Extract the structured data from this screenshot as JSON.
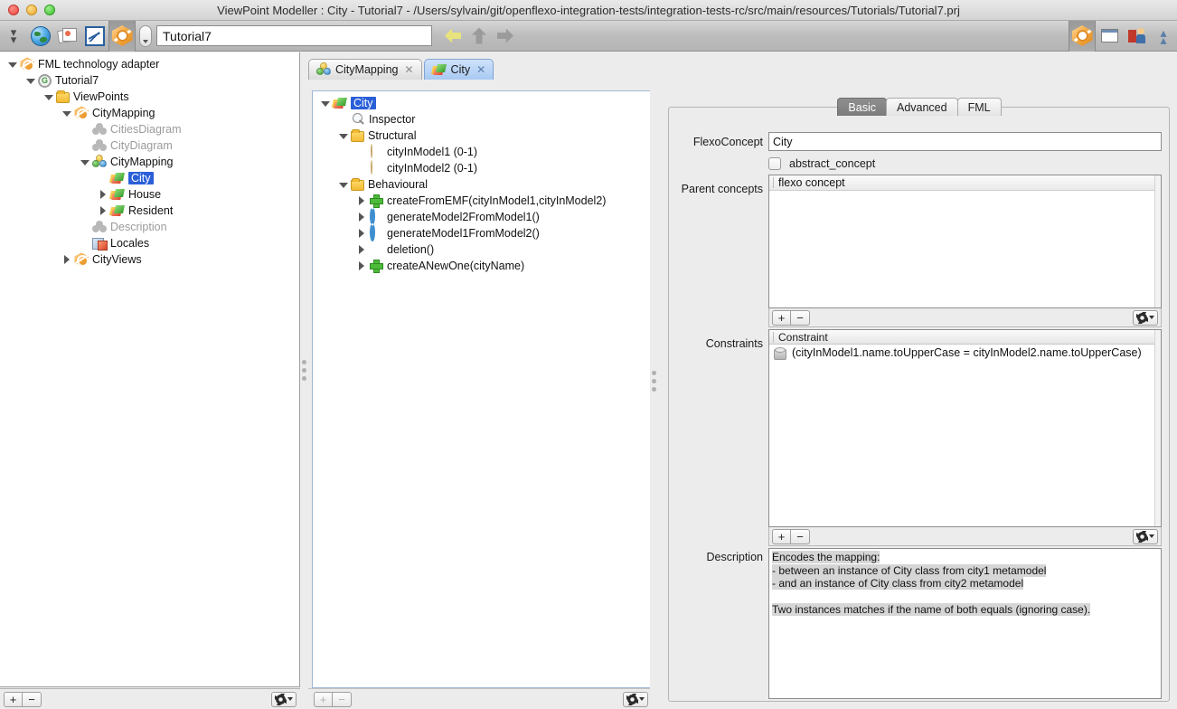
{
  "window": {
    "title": "ViewPoint Modeller : City - Tutorial7 - /Users/sylvain/git/openflexo-integration-tests/integration-tests-rc/src/main/resources/Tutorials/Tutorial7.prj"
  },
  "toolbar": {
    "icons": [
      "chevrons-down-icon",
      "globe-icon",
      "photos-icon",
      "pen-icon",
      "fml-icon"
    ],
    "combo_label": "",
    "url_value": "Tutorial7",
    "nav": [
      "back-arrow-icon",
      "up-arrow-icon",
      "forward-arrow-icon"
    ],
    "right_icons": [
      "fml-icon",
      "window-icon",
      "user-icon",
      "chevrons-up-icon"
    ]
  },
  "sidebar": {
    "items": [
      {
        "label": "FML technology adapter",
        "indent": 0,
        "twist": "down",
        "icon": "fml-icon",
        "dim": false,
        "selected": false
      },
      {
        "label": "Tutorial7",
        "indent": 1,
        "twist": "down",
        "icon": "project-icon",
        "dim": false,
        "selected": false
      },
      {
        "label": "ViewPoints",
        "indent": 2,
        "twist": "down",
        "icon": "folder-icon",
        "dim": false,
        "selected": false
      },
      {
        "label": "CityMapping",
        "indent": 3,
        "twist": "down",
        "icon": "fml-icon",
        "dim": false,
        "selected": false
      },
      {
        "label": "CitiesDiagram",
        "indent": 4,
        "twist": "none",
        "icon": "gray-cluster-icon",
        "dim": true,
        "selected": false
      },
      {
        "label": "CityDiagram",
        "indent": 4,
        "twist": "none",
        "icon": "gray-cluster-icon",
        "dim": true,
        "selected": false
      },
      {
        "label": "CityMapping",
        "indent": 4,
        "twist": "down",
        "icon": "virtual-model-icon",
        "dim": false,
        "selected": false
      },
      {
        "label": "City",
        "indent": 5,
        "twist": "none",
        "icon": "concept-icon",
        "dim": false,
        "selected": true
      },
      {
        "label": "House",
        "indent": 5,
        "twist": "right",
        "icon": "concept-icon",
        "dim": false,
        "selected": false
      },
      {
        "label": "Resident",
        "indent": 5,
        "twist": "right",
        "icon": "concept-icon",
        "dim": false,
        "selected": false
      },
      {
        "label": "Description",
        "indent": 4,
        "twist": "none",
        "icon": "gray-cluster-icon",
        "dim": true,
        "selected": false
      },
      {
        "label": "Locales",
        "indent": 4,
        "twist": "none",
        "icon": "locales-icon",
        "dim": false,
        "selected": false
      },
      {
        "label": "CityViews",
        "indent": 3,
        "twist": "right",
        "icon": "fml-icon",
        "dim": false,
        "selected": false
      }
    ],
    "footer": {
      "add_label": "+",
      "remove_label": "−",
      "gear": "gear-icon"
    }
  },
  "editor": {
    "tabs": [
      {
        "label": "CityMapping",
        "icon": "virtual-model-icon",
        "close": "✕",
        "active": false
      },
      {
        "label": "City",
        "icon": "concept-icon",
        "close": "✕",
        "active": true
      }
    ],
    "tree": [
      {
        "label": "City",
        "indent": 0,
        "twist": "down",
        "icon": "concept-icon",
        "selected": true
      },
      {
        "label": "Inspector",
        "indent": 1,
        "twist": "none",
        "icon": "magnifier-icon",
        "selected": false
      },
      {
        "label": "Structural",
        "indent": 1,
        "twist": "down",
        "icon": "folder-icon",
        "selected": false
      },
      {
        "label": "cityInModel1 (0-1)",
        "indent": 2,
        "twist": "none",
        "icon": "role-icon",
        "selected": false
      },
      {
        "label": "cityInModel2 (0-1)",
        "indent": 2,
        "twist": "none",
        "icon": "role-icon",
        "selected": false
      },
      {
        "label": "Behavioural",
        "indent": 1,
        "twist": "down",
        "icon": "folder-icon",
        "selected": false
      },
      {
        "label": "createFromEMF(cityInModel1,cityInModel2)",
        "indent": 2,
        "twist": "right",
        "icon": "green-plus-icon",
        "selected": false
      },
      {
        "label": "generateModel2FromModel1()",
        "indent": 2,
        "twist": "right",
        "icon": "refresh-icon",
        "selected": false
      },
      {
        "label": "generateModel1FromModel2()",
        "indent": 2,
        "twist": "right",
        "icon": "refresh-icon",
        "selected": false
      },
      {
        "label": "deletion()",
        "indent": 2,
        "twist": "right",
        "icon": "delete-icon",
        "selected": false
      },
      {
        "label": "createANewOne(cityName)",
        "indent": 2,
        "twist": "right",
        "icon": "green-plus-icon",
        "selected": false
      }
    ],
    "footer": {
      "add_label": "+",
      "remove_label": "−",
      "gear": "gear-icon"
    }
  },
  "inspector": {
    "tabs": [
      {
        "label": "Basic",
        "active": true
      },
      {
        "label": "Advanced",
        "active": false
      },
      {
        "label": "FML",
        "active": false
      }
    ],
    "flexo_concept": {
      "label": "FlexoConcept",
      "value": "City"
    },
    "abstract_concept": {
      "label": "abstract_concept",
      "checked": false
    },
    "parent_concepts": {
      "label": "Parent concepts",
      "rows": [
        "flexo concept"
      ],
      "toolbar": {
        "add_label": "+",
        "remove_label": "−",
        "gear": "gear-icon"
      }
    },
    "constraints": {
      "label": "Constraints",
      "column_header": "Constraint",
      "rows": [
        "(cityInModel1.name.toUpperCase = cityInModel2.name.toUpperCase)"
      ],
      "toolbar": {
        "add_label": "+",
        "remove_label": "−",
        "gear": "gear-icon"
      }
    },
    "description": {
      "label": "Description",
      "lines": [
        "Encodes the mapping:",
        "- between an instance of City class from city1 metamodel",
        "- and an instance of City class from city2 metamodel",
        "",
        "Two instances matches if the name of both equals (ignoring case)."
      ]
    }
  },
  "colors": {
    "selection_blue": "#2a5fd8",
    "active_tab_blue": "#a8c9f2",
    "panel_gray": "#ececec",
    "accent_orange": "#f2a63c"
  }
}
